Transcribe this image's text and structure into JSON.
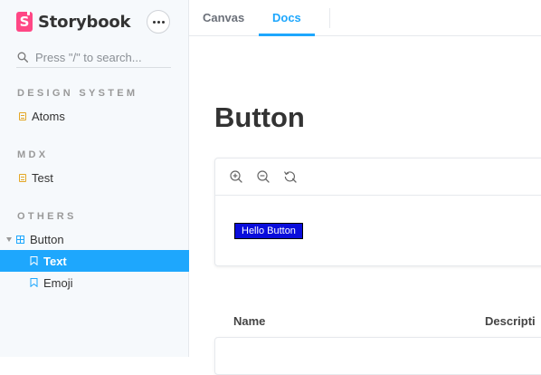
{
  "sidebar": {
    "brand": "Storybook",
    "menu_icon": "ellipsis-icon",
    "search_placeholder": "Press \"/\" to search...",
    "sections": [
      {
        "title": "DESIGN SYSTEM",
        "items": [
          {
            "label": "Atoms",
            "icon": "document-icon"
          }
        ]
      },
      {
        "title": "MDX",
        "items": [
          {
            "label": "Test",
            "icon": "document-icon"
          }
        ]
      },
      {
        "title": "OTHERS",
        "items": [
          {
            "label": "Button",
            "icon": "component-icon",
            "expanded": true
          },
          {
            "label": "Text",
            "icon": "bookmark-icon",
            "active": true
          },
          {
            "label": "Emoji",
            "icon": "bookmark-icon"
          }
        ]
      }
    ]
  },
  "tabs": [
    {
      "label": "Canvas",
      "active": false
    },
    {
      "label": "Docs",
      "active": true
    }
  ],
  "main": {
    "title": "Button",
    "toolbar_icons": [
      "zoom-in-icon",
      "zoom-out-icon",
      "reset-zoom-icon"
    ],
    "demo_button": "Hello Button",
    "props_headers": [
      "Name",
      "Descripti"
    ]
  },
  "colors": {
    "accent": "#1ea7fd",
    "brand": "#ff4785",
    "demo_button_bg": "#0a0ddc"
  }
}
